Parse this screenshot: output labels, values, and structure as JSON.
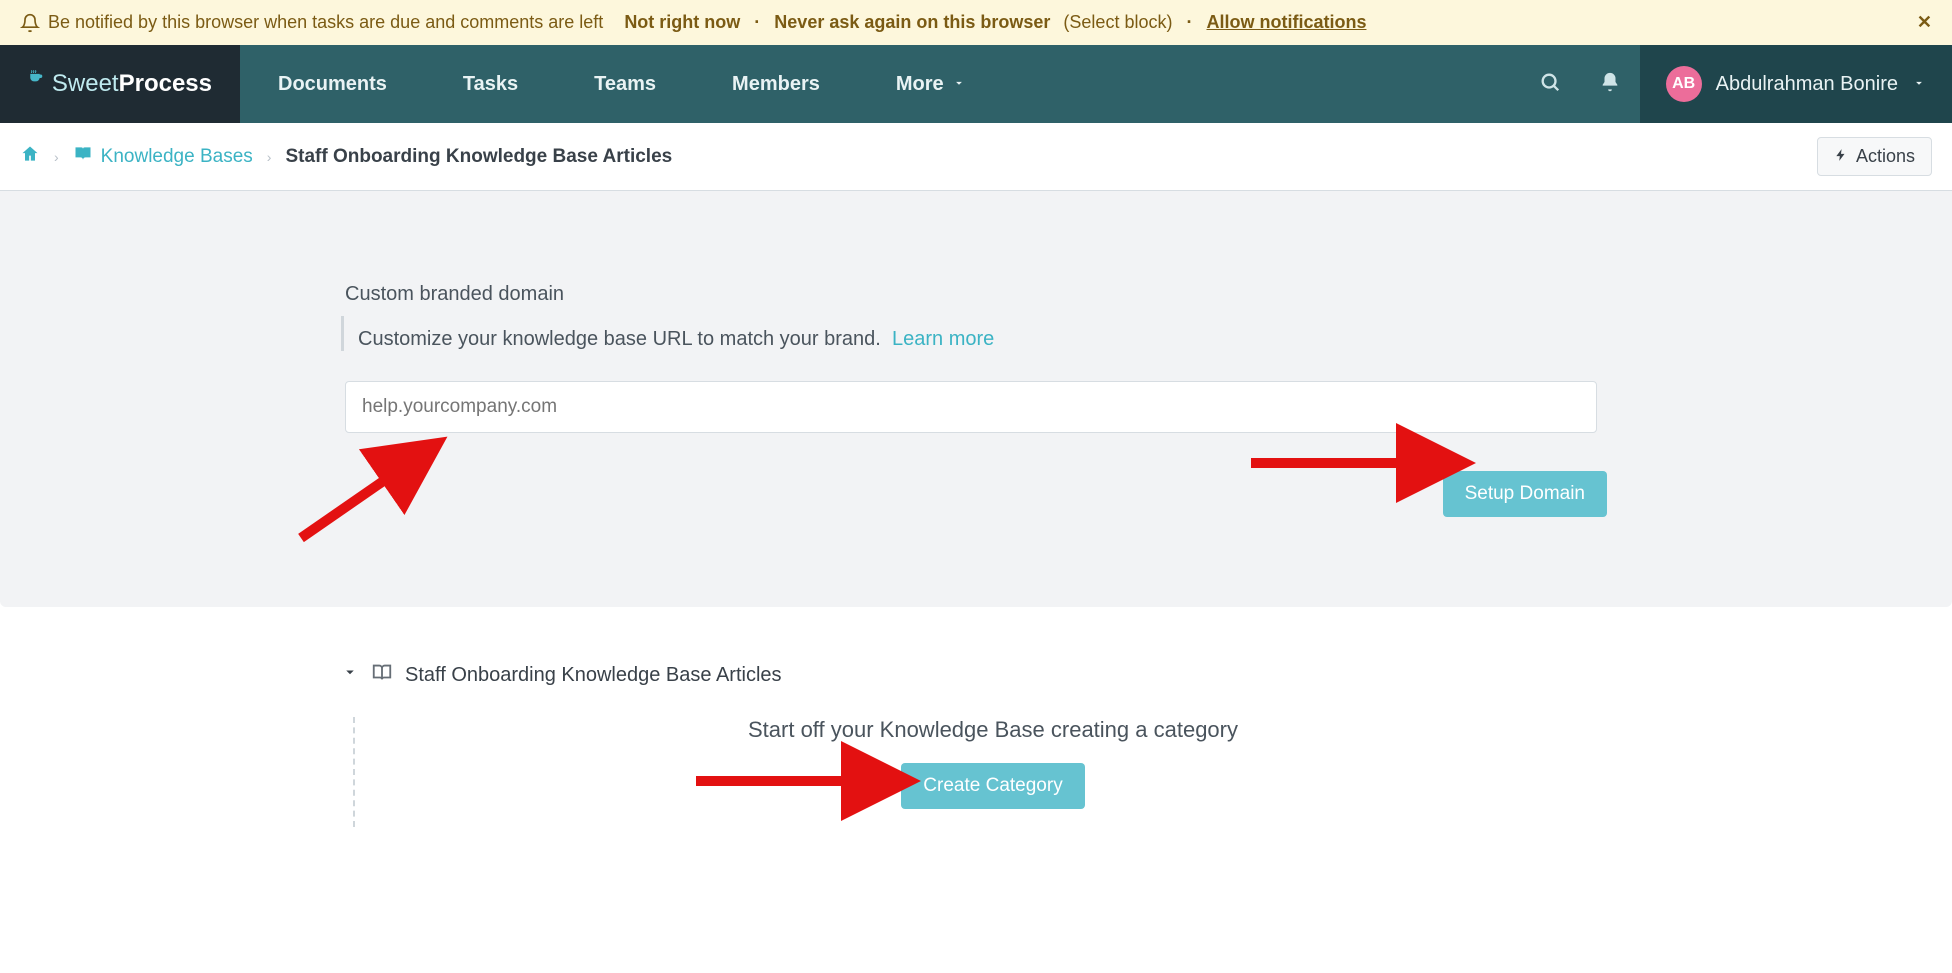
{
  "notify": {
    "msg": "Be notified by this browser when tasks are due and comments are left",
    "not_now": "Not right now",
    "never": "Never ask again on this browser",
    "select_block": "(Select block)",
    "allow": "Allow notifications"
  },
  "brand": {
    "light": "Sweet",
    "bold": "Process"
  },
  "nav": {
    "documents": "Documents",
    "tasks": "Tasks",
    "teams": "Teams",
    "members": "Members",
    "more": "More"
  },
  "user": {
    "initials": "AB",
    "name": "Abdulrahman Bonire"
  },
  "crumbs": {
    "kb": "Knowledge Bases",
    "current": "Staff Onboarding Knowledge Base Articles",
    "actions": "Actions"
  },
  "cbd": {
    "label": "Custom branded domain",
    "desc": "Customize your knowledge base URL to match your brand.",
    "learn": "Learn more",
    "placeholder": "help.yourcompany.com",
    "setup": "Setup Domain"
  },
  "kb": {
    "title": "Staff Onboarding Knowledge Base Articles",
    "start": "Start off your Knowledge Base creating a category",
    "create": "Create Category"
  }
}
